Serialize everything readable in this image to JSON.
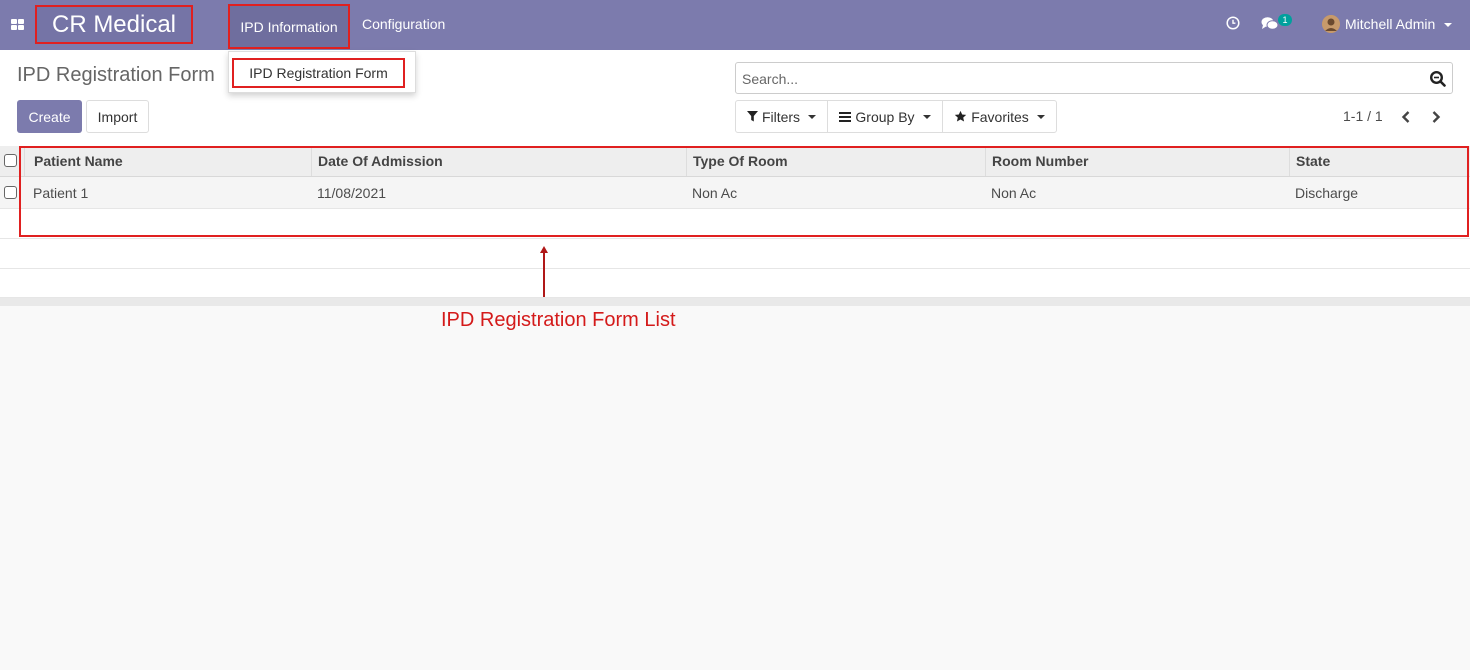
{
  "navbar": {
    "apps_icon": "apps-grid-icon",
    "brand": "CR Medical",
    "menus": [
      {
        "label": "IPD Information"
      },
      {
        "label": "Configuration"
      }
    ],
    "activity_icon": "clock-icon",
    "messages_icon": "chat-icon",
    "messages_count": "1",
    "user_name": "Mitchell Admin"
  },
  "dropdown": {
    "items": [
      {
        "label": "IPD Registration Form"
      }
    ]
  },
  "control_panel": {
    "title": "IPD Registration Form",
    "create_label": "Create",
    "import_label": "Import",
    "search_placeholder": "Search...",
    "filters_label": "Filters",
    "groupby_label": "Group By",
    "favorites_label": "Favorites",
    "pager_value": "1-1 / 1"
  },
  "table": {
    "columns": [
      "Patient Name",
      "Date Of Admission",
      "Type Of Room",
      "Room Number",
      "State"
    ],
    "rows": [
      [
        "Patient 1",
        "11/08/2021",
        "Non Ac",
        "Non Ac",
        "Discharge"
      ]
    ]
  },
  "annotation": {
    "label": "IPD Registration Form List",
    "color": "#e02020"
  },
  "colors": {
    "brand": "#7c7bad",
    "annotation": "#e02020"
  }
}
